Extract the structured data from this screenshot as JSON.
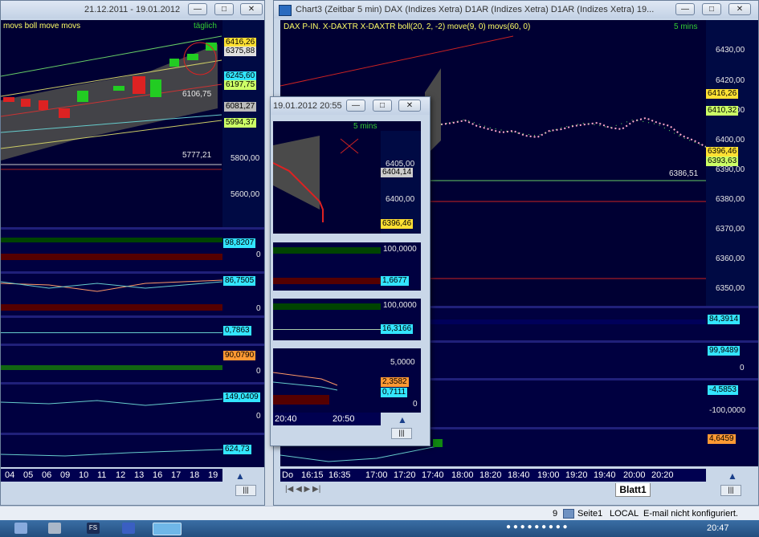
{
  "left_window": {
    "title": "21.12.2011 - 19.01.2012",
    "header_text": "movs boll move movs",
    "period_label": "täglich",
    "price_ticks": [
      "5800,00",
      "5600,00"
    ],
    "price_tags": [
      "6416,26",
      "6375,88",
      "6245,60",
      "6197,75",
      "6081,27",
      "5994,37"
    ],
    "annotations": [
      "6106,75",
      "5777,21"
    ],
    "indicator_tags": [
      "98,8207",
      "86,7505",
      "0,7863",
      "90,0790",
      "149,0409",
      "624,73"
    ],
    "indicator_zero": "0",
    "x_labels": [
      "04",
      "05",
      "06",
      "09",
      "10",
      "11",
      "12",
      "13",
      "16",
      "17",
      "18",
      "19"
    ]
  },
  "main_window": {
    "title": "Chart3 (Zeitbar 5 min)  DAX (Indizes Xetra) D1AR (Indizes Xetra) D1AR (Indizes Xetra) 19...",
    "header_text": "DAX P-IN.  X-DAXTR X-DAXTR boll(20, 2, -2) move(9, 0) movs(60, 0)",
    "period_label": "5 mins",
    "price_ticks": [
      "6430,00",
      "6420,00",
      "6410,00",
      "6400,00",
      "6390,00",
      "6380,00",
      "6370,00",
      "6360,00",
      "6350,00"
    ],
    "price_tags": [
      "6416,26",
      "6410,32",
      "6396,46",
      "6393,63"
    ],
    "annotation": "6386,51",
    "indicator_tags": [
      "84,3914",
      "99,9489",
      "-4,5853",
      "-100,0000",
      "4,6459"
    ],
    "indicator_zero": "0",
    "x_labels": [
      "Do",
      "16:15",
      "16:35",
      "17:00",
      "17:20",
      "17:40",
      "18:00",
      "18:20",
      "18:40",
      "19:00",
      "19:20",
      "19:40",
      "20:00",
      "20:20"
    ],
    "sheet_tab": "Blatt1"
  },
  "popup_window": {
    "title": "19.01.2012 20:55",
    "period_label": "5 mins",
    "price_ticks": [
      "6405,00",
      "6400,00"
    ],
    "price_tags": [
      "6404,14",
      "6396,46"
    ],
    "indicator_ticks": [
      "100,0000",
      "100,0000",
      "5,0000"
    ],
    "indicator_tags": [
      "1,6677",
      "16,3166",
      "2,3582",
      "0,7111"
    ],
    "indicator_zero": "0",
    "x_labels": [
      "20:40",
      "20:50"
    ]
  },
  "status_bar": {
    "count": "9",
    "page": "Seite1",
    "mode": "LOCAL",
    "email": "E-mail nicht konfiguriert."
  },
  "taskbar": {
    "clock": "20:47",
    "apps": [
      "FS"
    ]
  }
}
